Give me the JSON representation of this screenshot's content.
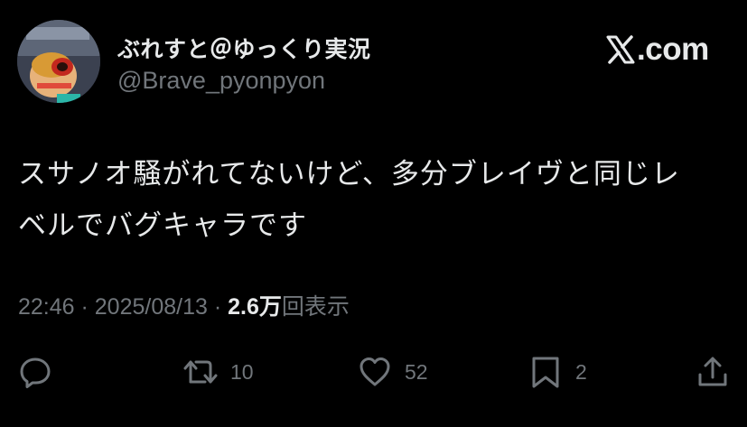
{
  "header": {
    "display_name": "ぶれすと＠ゆっくり実況",
    "handle": "@Brave_pyonpyon",
    "brand_text": ".com"
  },
  "tweet": {
    "text_line1": "スサノオ騒がれてないけど、多分ブレイヴと同じレ",
    "text_line2": "ベルでバグキャラです"
  },
  "meta": {
    "time": "22:46",
    "separator1": " · ",
    "date": "2025/08/13",
    "separator2": " · ",
    "views_count": "2.6万",
    "views_label": "回表示"
  },
  "actions": {
    "reply": {
      "icon": "reply-icon"
    },
    "retweet": {
      "icon": "retweet-icon",
      "count": "10"
    },
    "like": {
      "icon": "heart-icon",
      "count": "52"
    },
    "bookmark": {
      "icon": "bookmark-icon",
      "count": "2"
    },
    "share": {
      "icon": "share-icon"
    }
  },
  "colors": {
    "background": "#000000",
    "primary_text": "#e7e9ea",
    "secondary_text": "#71767b"
  }
}
